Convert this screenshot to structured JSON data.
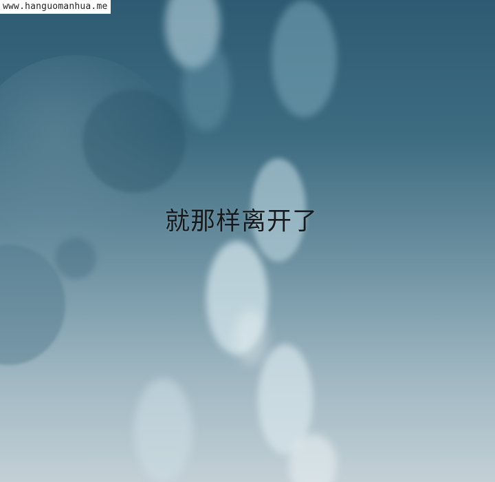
{
  "watermark": {
    "text": "www.hanguomanhua.me"
  },
  "caption": {
    "text": "就那样离开了"
  },
  "colors": {
    "sky_top": "#2e5b73",
    "sky_bottom": "#c3d0d6",
    "caption_text": "#151a1e",
    "watermark_bg": "#ffffff"
  }
}
